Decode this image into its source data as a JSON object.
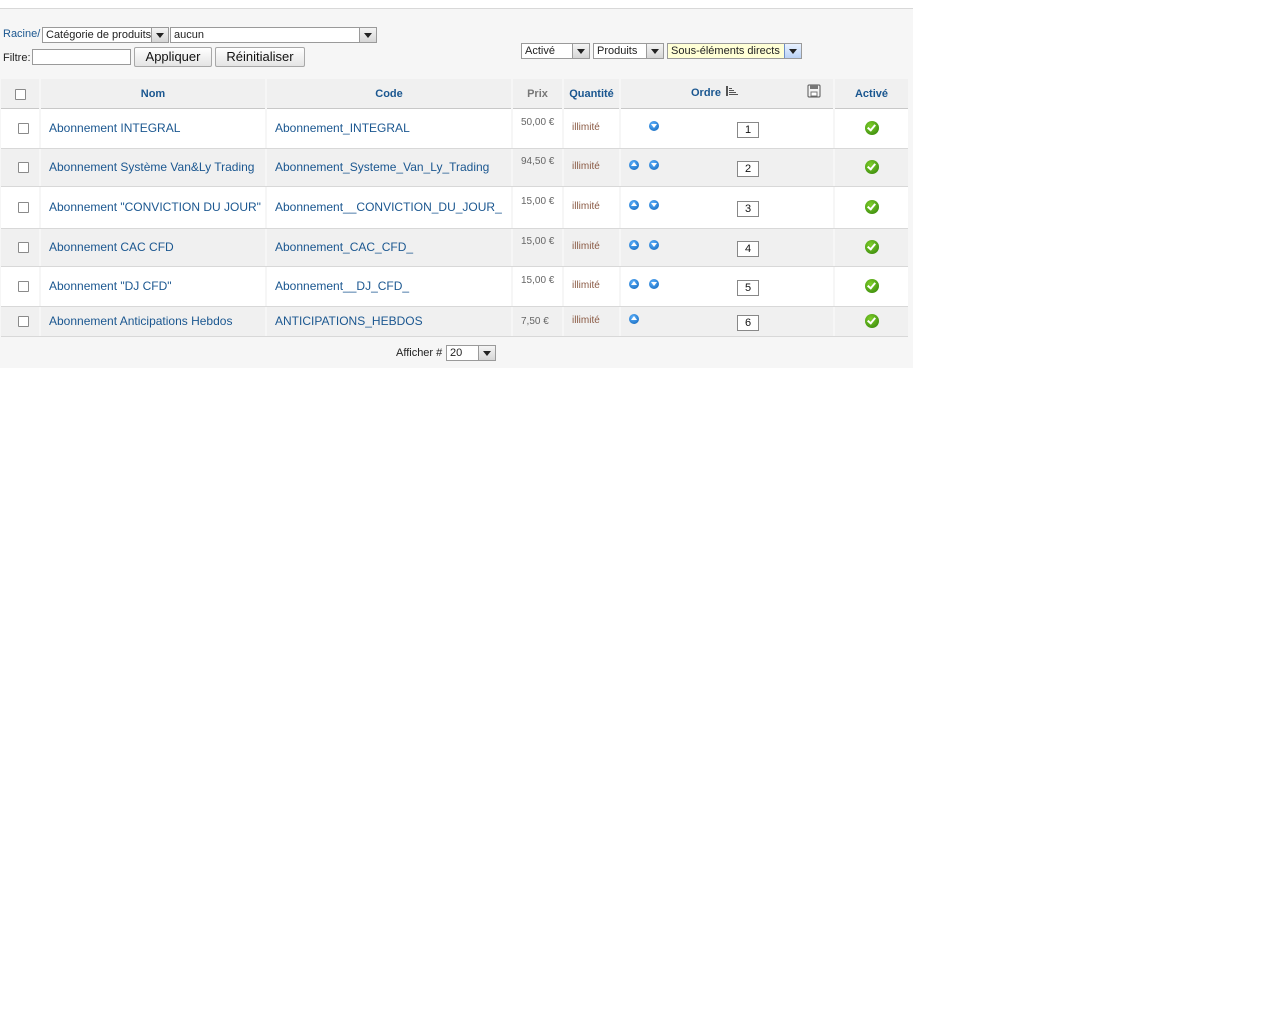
{
  "breadcrumb": {
    "root_label": "Racine/"
  },
  "category_type_select": {
    "value": "Catégorie de produits"
  },
  "category_select": {
    "value": "aucun"
  },
  "filter": {
    "label": "Filtre:",
    "value": "",
    "apply_label": "Appliquer",
    "reset_label": "Réinitialiser"
  },
  "state_select": {
    "value": "Activé"
  },
  "type_select": {
    "value": "Produits"
  },
  "depth_select": {
    "value": "Sous-éléments directs"
  },
  "columns": {
    "name": "Nom",
    "code": "Code",
    "price": "Prix",
    "quantity": "Quantité",
    "order": "Ordre",
    "active": "Activé"
  },
  "rows": [
    {
      "name": "Abonnement INTEGRAL",
      "code": "Abonnement_INTEGRAL",
      "price": "50,00 €",
      "quantity": "illimité",
      "order": "1",
      "up": false,
      "down": true
    },
    {
      "name": "Abonnement Système Van&Ly Trading",
      "code": "Abonnement_Systeme_Van_Ly_Trading",
      "price": "94,50 €",
      "quantity": "illimité",
      "order": "2",
      "up": true,
      "down": true
    },
    {
      "name": "Abonnement \"CONVICTION DU JOUR\"",
      "code": "Abonnement__CONVICTION_DU_JOUR_",
      "price": "15,00 €",
      "quantity": "illimité",
      "order": "3",
      "up": true,
      "down": true
    },
    {
      "name": "Abonnement CAC CFD",
      "code": "Abonnement_CAC_CFD_",
      "price": "15,00 €",
      "quantity": "illimité",
      "order": "4",
      "up": true,
      "down": true
    },
    {
      "name": "Abonnement \"DJ CFD\"",
      "code": "Abonnement__DJ_CFD_",
      "price": "15,00 €",
      "quantity": "illimité",
      "order": "5",
      "up": true,
      "down": true
    },
    {
      "name": "Abonnement Anticipations Hebdos",
      "code": "ANTICIPATIONS_HEBDOS",
      "price": "7,50 €",
      "quantity": "illimité",
      "order": "6",
      "up": true,
      "down": false
    }
  ],
  "pagination": {
    "display_label": "Afficher #",
    "per_page": "20"
  },
  "colors": {
    "link": "#1b5790",
    "active_check": "#3f8f0f",
    "order_arrow": "#0a5fb4"
  }
}
